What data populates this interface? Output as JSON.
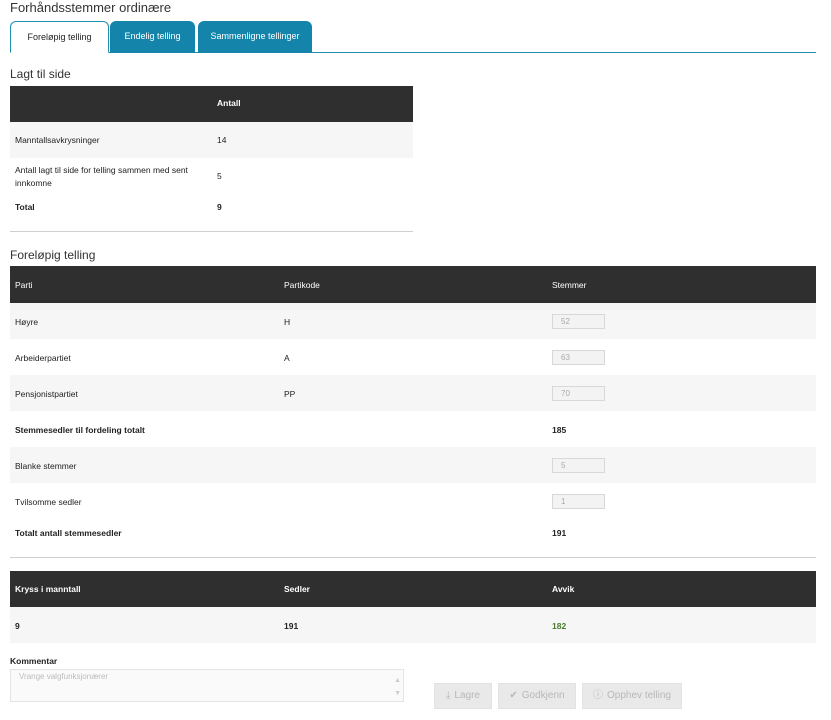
{
  "page": {
    "title": "Forhåndsstemmer ordinære"
  },
  "tabs": [
    {
      "label": "Foreløpig telling",
      "active": true
    },
    {
      "label": "Endelig telling",
      "active": false
    },
    {
      "label": "Sammenligne tellinger",
      "active": false
    }
  ],
  "colors": {
    "tab_accent": "#1584aa",
    "header_bg": "#2f2f2f",
    "deviation_value": "#4a7a2a"
  },
  "aside": {
    "title": "Lagt til side",
    "header": {
      "col2": "Antall"
    },
    "rows": [
      {
        "label": "Manntallsavkrysninger",
        "value": "14"
      },
      {
        "label": "Antall lagt til side for telling sammen med sent innkomne",
        "value": "5"
      },
      {
        "label": "Total",
        "value": "9"
      }
    ]
  },
  "prelim": {
    "title": "Foreløpig telling",
    "header": {
      "col1": "Parti",
      "col2": "Partikode",
      "col3": "Stemmer"
    },
    "parties": [
      {
        "name": "Høyre",
        "code": "H",
        "votes": "52"
      },
      {
        "name": "Arbeiderpartiet",
        "code": "A",
        "votes": "63"
      },
      {
        "name": "Pensjonistpartiet",
        "code": "PP",
        "votes": "70"
      }
    ],
    "total_distribution": {
      "label": "Stemmesedler til fordeling totalt",
      "value": "185"
    },
    "blank": {
      "label": "Blanke stemmer",
      "value": "5"
    },
    "doubtful": {
      "label": "Tvilsomme sedler",
      "value": "1"
    },
    "total_ballots": {
      "label": "Totalt antall stemmesedler",
      "value": "191"
    }
  },
  "compare": {
    "header": {
      "col1": "Kryss i manntall",
      "col2": "Sedler",
      "col3": "Avvik"
    },
    "values": {
      "col1": "9",
      "col2": "191",
      "col3": "182"
    }
  },
  "comment": {
    "label": "Kommentar",
    "placeholder": "Vrange valgfunksjonærer"
  },
  "buttons": {
    "save": {
      "label": "Lagre",
      "icon": "download-icon"
    },
    "approve": {
      "label": "Godkjenn",
      "icon": "check-icon"
    },
    "revoke": {
      "label": "Opphev telling",
      "icon": "info-icon"
    }
  }
}
